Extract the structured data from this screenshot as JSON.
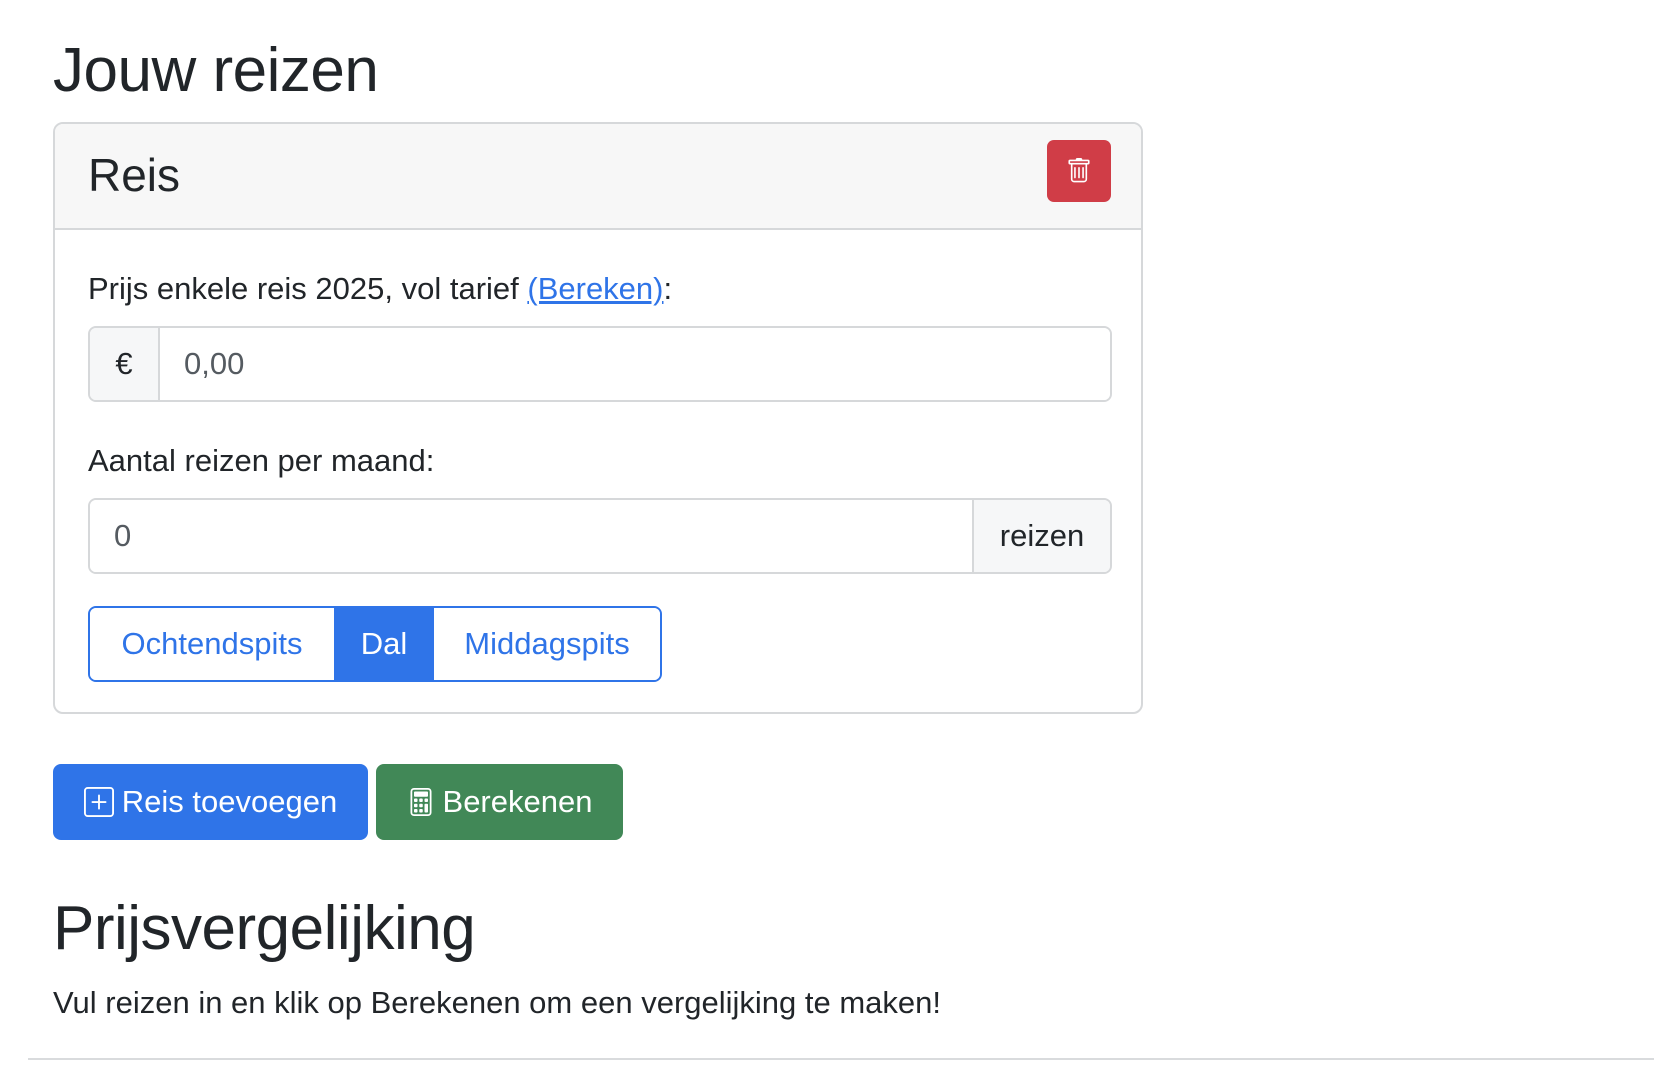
{
  "sections": {
    "trips_title": "Jouw reizen",
    "comparison_title": "Prijsvergelijking",
    "comparison_intro": "Vul reizen in en klik op Berekenen om een vergelijking te maken!"
  },
  "trip_card": {
    "title": "Reis",
    "delete_icon": "trash-icon",
    "price_label_prefix": "Prijs enkele reis 2025, vol tarief ",
    "price_label_link": "(Bereken)",
    "price_label_suffix": ":",
    "currency_symbol": "€",
    "price_placeholder": "0,00",
    "count_label": "Aantal reizen per maand:",
    "count_placeholder": "0",
    "count_unit": "reizen",
    "time_options": [
      {
        "label": "Ochtendspits",
        "active": false
      },
      {
        "label": "Dal",
        "active": true
      },
      {
        "label": "Middagspits",
        "active": false
      }
    ]
  },
  "actions": {
    "add_label": "Reis toevoegen",
    "add_icon": "plus-square-icon",
    "calc_label": "Berekenen",
    "calc_icon": "calculator-icon"
  },
  "colors": {
    "primary": "#2f74e8",
    "danger": "#d03d47",
    "success": "#418857"
  }
}
